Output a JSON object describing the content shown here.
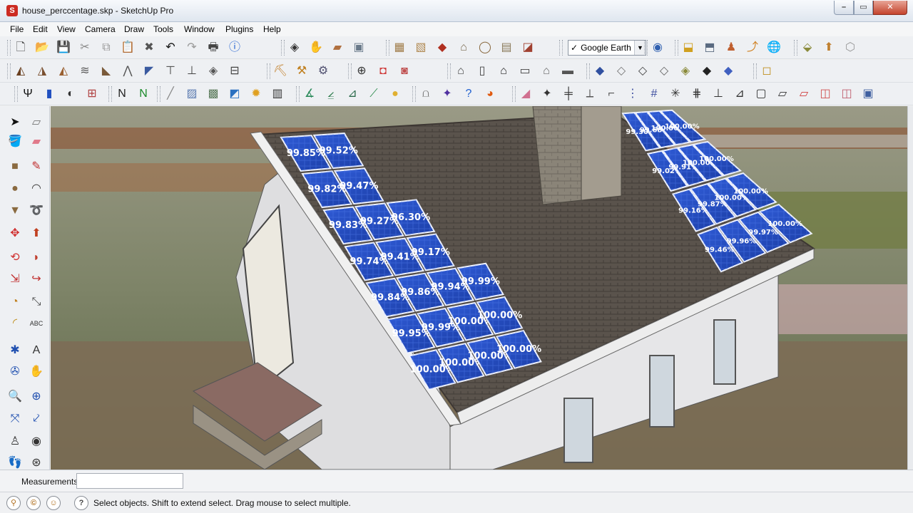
{
  "window": {
    "title": "house_perccentage.skp - SketchUp Pro",
    "icon_glyph": "S",
    "minimize_glyph": "–",
    "maximize_glyph": "▭",
    "close_glyph": "✕"
  },
  "menu": [
    {
      "label": "File",
      "name": "menu-file"
    },
    {
      "label": "Edit",
      "name": "menu-edit"
    },
    {
      "label": "View",
      "name": "menu-view"
    },
    {
      "label": "Camera",
      "name": "menu-camera"
    },
    {
      "label": "Draw",
      "name": "menu-draw"
    },
    {
      "label": "Tools",
      "name": "menu-tools"
    },
    {
      "label": "Window",
      "name": "menu-window"
    },
    {
      "label": "Plugins",
      "name": "menu-plugins"
    },
    {
      "label": "Help",
      "name": "menu-help"
    }
  ],
  "toolbar_rows": [
    {
      "groups": [
        {
          "icons": [
            {
              "name": "new-file-icon",
              "glyph": "🗋",
              "color": "#444444"
            },
            {
              "name": "open-folder-icon",
              "glyph": "📂",
              "color": "#b58a2a"
            },
            {
              "name": "save-icon",
              "glyph": "💾",
              "color": "#2a4f8f"
            },
            {
              "name": "cut-icon",
              "glyph": "✂",
              "color": "#888888"
            },
            {
              "name": "copy-icon",
              "glyph": "⧉",
              "color": "#999999"
            },
            {
              "name": "paste-icon",
              "glyph": "📋",
              "color": "#999999"
            },
            {
              "name": "erase-icon",
              "glyph": "✖",
              "color": "#555555"
            },
            {
              "name": "undo-icon",
              "glyph": "↶",
              "color": "#111111"
            },
            {
              "name": "redo-icon",
              "glyph": "↷",
              "color": "#999999"
            },
            {
              "name": "print-icon",
              "glyph": "🖶",
              "color": "#444444"
            },
            {
              "name": "model-info-icon",
              "glyph": "ⓘ",
              "color": "#1f5fd0"
            }
          ]
        },
        {
          "icons": [
            {
              "name": "make-component-icon",
              "glyph": "◈",
              "color": "#333333"
            },
            {
              "name": "paint-bucket-icon",
              "glyph": "✋",
              "color": "#444444"
            },
            {
              "name": "eraser-tool-icon",
              "glyph": "▰",
              "color": "#b07040"
            },
            {
              "name": "tape-measure-icon",
              "glyph": "▣",
              "color": "#6a7a8a"
            }
          ]
        },
        {
          "icons": [
            {
              "name": "section-plane-icon",
              "glyph": "▦",
              "color": "#a07c48"
            },
            {
              "name": "texture-icon",
              "glyph": "▧",
              "color": "#b08850"
            },
            {
              "name": "push-pull-red-icon",
              "glyph": "◆",
              "color": "#b03020"
            },
            {
              "name": "house-box-icon",
              "glyph": "⌂",
              "color": "#7a6a50"
            },
            {
              "name": "circle-tool-icon",
              "glyph": "◯",
              "color": "#8a6a40"
            },
            {
              "name": "follow-me-icon",
              "glyph": "▤",
              "color": "#8a7a5a"
            },
            {
              "name": "offset-icon",
              "glyph": "◪",
              "color": "#a04030"
            }
          ]
        },
        {
          "icons": [
            {
              "name": "google-earth-get-icon",
              "glyph": "◉",
              "color": "#3060b0"
            }
          ]
        },
        {
          "icons": [
            {
              "name": "get-models-icon",
              "glyph": "⬓",
              "color": "#d0a020"
            },
            {
              "name": "share-model-icon",
              "glyph": "⬒",
              "color": "#5a6a80"
            },
            {
              "name": "person-icon",
              "glyph": "♟",
              "color": "#c06030"
            },
            {
              "name": "axes-icon",
              "glyph": "⤴",
              "color": "#d08020"
            },
            {
              "name": "globe-icon",
              "glyph": "🌐",
              "color": "#2a70c0"
            }
          ]
        },
        {
          "icons": [
            {
              "name": "photo-texture-icon",
              "glyph": "⬙",
              "color": "#8a8a3a"
            },
            {
              "name": "upload-icon",
              "glyph": "⬆",
              "color": "#c08030"
            },
            {
              "name": "cube-outline-icon",
              "glyph": "⬡",
              "color": "#999999"
            }
          ]
        }
      ],
      "google_earth_select": {
        "checkbox": "✓",
        "value": "Google Earth",
        "arrow": "▼"
      }
    },
    {
      "groups": [
        {
          "icons": [
            {
              "name": "roof-tool-1-icon",
              "glyph": "◭",
              "color": "#6a4020"
            },
            {
              "name": "roof-tool-2-icon",
              "glyph": "◮",
              "color": "#7a5030"
            },
            {
              "name": "roof-tool-3-icon",
              "glyph": "◭",
              "color": "#9a6030"
            },
            {
              "name": "stairs-icon",
              "glyph": "≋",
              "color": "#5a5a5a"
            },
            {
              "name": "roof-tool-4-icon",
              "glyph": "◣",
              "color": "#7a5a3a"
            },
            {
              "name": "truss-icon",
              "glyph": "⋀",
              "color": "#555555"
            },
            {
              "name": "roof-tool-5-icon",
              "glyph": "◤",
              "color": "#3a5aa0"
            },
            {
              "name": "column-t-icon",
              "glyph": "⊤",
              "color": "#444444"
            },
            {
              "name": "column-tt-icon",
              "glyph": "⊥",
              "color": "#444444"
            },
            {
              "name": "roof-tool-6-icon",
              "glyph": "◈",
              "color": "#555555"
            },
            {
              "name": "foundation-icon",
              "glyph": "⊟",
              "color": "#444444"
            }
          ]
        },
        {
          "icons": [
            {
              "name": "sandbox-icon",
              "glyph": "⛏",
              "color": "#c07a20"
            },
            {
              "name": "terrain-icon",
              "glyph": "⚒",
              "color": "#c08020"
            },
            {
              "name": "terrain-scale-icon",
              "glyph": "⚙",
              "color": "#505070"
            }
          ]
        },
        {
          "icons": [
            {
              "name": "ruby-console-icon",
              "glyph": "⊕",
              "color": "#333333"
            },
            {
              "name": "cube-red-1-icon",
              "glyph": "◘",
              "color": "#d04040"
            },
            {
              "name": "cube-red-2-icon",
              "glyph": "◙",
              "color": "#c05050"
            }
          ]
        },
        {
          "icons": [
            {
              "name": "view-iso-icon",
              "glyph": "⌂",
              "color": "#444444"
            },
            {
              "name": "view-top-icon",
              "glyph": "▯",
              "color": "#444444"
            },
            {
              "name": "view-front-icon",
              "glyph": "⌂",
              "color": "#222222"
            },
            {
              "name": "view-right-icon",
              "glyph": "▭",
              "color": "#444444"
            },
            {
              "name": "view-back-icon",
              "glyph": "⌂",
              "color": "#666666"
            },
            {
              "name": "view-left-icon",
              "glyph": "▬",
              "color": "#555555"
            }
          ]
        },
        {
          "icons": [
            {
              "name": "xray-style-icon",
              "glyph": "◆",
              "color": "#3050a0"
            },
            {
              "name": "wireframe-style-icon",
              "glyph": "◇",
              "color": "#777777"
            },
            {
              "name": "hidden-line-style-icon",
              "glyph": "◇",
              "color": "#444444"
            },
            {
              "name": "shaded-style-icon",
              "glyph": "◇",
              "color": "#666666"
            },
            {
              "name": "shaded-texture-style-icon",
              "glyph": "◈",
              "color": "#8a8a3a"
            },
            {
              "name": "monochrome-style-icon",
              "glyph": "◆",
              "color": "#222222"
            },
            {
              "name": "back-edges-style-icon",
              "glyph": "◆",
              "color": "#4060c0"
            }
          ]
        },
        {
          "icons": [
            {
              "name": "component-box-icon",
              "glyph": "◻",
              "color": "#c09020"
            }
          ]
        }
      ]
    },
    {
      "groups": [
        {
          "icons": [
            {
              "name": "psi-icon",
              "glyph": "Ψ",
              "color": "#111111"
            },
            {
              "name": "blue-panel-icon",
              "glyph": "▮",
              "color": "#2050c0"
            },
            {
              "name": "moon-icon",
              "glyph": "◐",
              "color": "#333333"
            },
            {
              "name": "render-icon",
              "glyph": "⊞",
              "color": "#b04040"
            }
          ]
        },
        {
          "icons": [
            {
              "name": "n-plugin-icon",
              "glyph": "N",
              "color": "#222222"
            },
            {
              "name": "green-n-plugin-icon",
              "glyph": "N",
              "color": "#1a8a2a"
            }
          ]
        },
        {
          "icons": [
            {
              "name": "ruler-icon",
              "glyph": "╱",
              "color": "#888888"
            },
            {
              "name": "doc-icon",
              "glyph": "▨",
              "color": "#5a7ab0"
            },
            {
              "name": "image-icon",
              "glyph": "▩",
              "color": "#5a7a5a"
            },
            {
              "name": "map-icon",
              "glyph": "◩",
              "color": "#2a70c0"
            },
            {
              "name": "sun-icon",
              "glyph": "✹",
              "color": "#e0a020"
            },
            {
              "name": "chart-icon",
              "glyph": "▥",
              "color": "#333333"
            }
          ]
        },
        {
          "icons": [
            {
              "name": "angle-icon",
              "glyph": "∡",
              "color": "#2a8a5a"
            },
            {
              "name": "protractor-icon",
              "glyph": "⦤",
              "color": "#2a7a4a"
            },
            {
              "name": "utm-icon",
              "glyph": "⊿",
              "color": "#2a6a4a"
            },
            {
              "name": "slope-icon",
              "glyph": "⟋",
              "color": "#2a8a4a"
            },
            {
              "name": "sun-disc-icon",
              "glyph": "●",
              "color": "#e0b030"
            }
          ]
        },
        {
          "icons": [
            {
              "name": "arch-icon",
              "glyph": "⩍",
              "color": "#777777"
            },
            {
              "name": "compass-icon",
              "glyph": "✦",
              "color": "#5030a0"
            },
            {
              "name": "help-icon",
              "glyph": "?",
              "color": "#2060d0"
            },
            {
              "name": "fire-icon",
              "glyph": "◕",
              "color": "#e05a10"
            }
          ]
        },
        {
          "icons": [
            {
              "name": "pink-eraser-icon",
              "glyph": "◢",
              "color": "#d07090"
            },
            {
              "name": "point-icon",
              "glyph": "✦",
              "color": "#333333"
            },
            {
              "name": "grid-icon",
              "glyph": "╪",
              "color": "#333333"
            },
            {
              "name": "dim-icon",
              "glyph": "⟂",
              "color": "#555555"
            },
            {
              "name": "bracket-icon",
              "glyph": "⌐",
              "color": "#555555"
            },
            {
              "name": "dots-grid-icon",
              "glyph": "⋮",
              "color": "#4050a0"
            },
            {
              "name": "hash-grid-icon",
              "glyph": "#",
              "color": "#4050a0"
            },
            {
              "name": "star-axes-icon",
              "glyph": "✳",
              "color": "#333333"
            },
            {
              "name": "lattice-icon",
              "glyph": "⋕",
              "color": "#333333"
            },
            {
              "name": "post-icon",
              "glyph": "⊥",
              "color": "#333333"
            },
            {
              "name": "ramp-icon",
              "glyph": "⊿",
              "color": "#333333"
            },
            {
              "name": "frame-icon",
              "glyph": "▢",
              "color": "#333333"
            },
            {
              "name": "box-3d-icon",
              "glyph": "▱",
              "color": "#333333"
            },
            {
              "name": "slant-box-icon",
              "glyph": "▱",
              "color": "#d04040"
            },
            {
              "name": "pink-box-1-icon",
              "glyph": "◫",
              "color": "#d05050"
            },
            {
              "name": "pink-box-2-icon",
              "glyph": "◫",
              "color": "#c06070"
            },
            {
              "name": "multi-box-icon",
              "glyph": "▣",
              "color": "#4060a0"
            }
          ]
        }
      ]
    }
  ],
  "left_tools": [
    {
      "name": "select-tool-icon",
      "glyph": "➤",
      "color": "#111111"
    },
    {
      "name": "make-component-tool-icon",
      "glyph": "▱",
      "color": "#777777"
    },
    {
      "name": "paint-bucket-tool-icon",
      "glyph": "🪣",
      "color": "#b08020"
    },
    {
      "name": "eraser-icon",
      "glyph": "▰",
      "color": "#e07a8a"
    },
    {
      "name": "rectangle-tool-icon",
      "glyph": "■",
      "color": "#8a6a40"
    },
    {
      "name": "line-tool-icon",
      "glyph": "✎",
      "color": "#c03030"
    },
    {
      "name": "circle-icon",
      "glyph": "●",
      "color": "#8a6a40"
    },
    {
      "name": "arc-tool-icon",
      "glyph": "◠",
      "color": "#444444"
    },
    {
      "name": "polygon-tool-icon",
      "glyph": "▼",
      "color": "#8a6a40"
    },
    {
      "name": "freehand-tool-icon",
      "glyph": "➰",
      "color": "#444444"
    },
    {
      "name": "move-tool-icon",
      "glyph": "✥",
      "color": "#d03030"
    },
    {
      "name": "push-pull-tool-icon",
      "glyph": "⬆",
      "color": "#c04020"
    },
    {
      "name": "rotate-tool-icon",
      "glyph": "⟲",
      "color": "#d03030"
    },
    {
      "name": "follow-me-tool-icon",
      "glyph": "◗",
      "color": "#c04030"
    },
    {
      "name": "scale-tool-icon",
      "glyph": "⇲",
      "color": "#c03030"
    },
    {
      "name": "offset-tool-icon",
      "glyph": "↪",
      "color": "#c03030"
    },
    {
      "name": "tape-measure-tool-icon",
      "glyph": "◔",
      "color": "#c08020"
    },
    {
      "name": "dimension-tool-icon",
      "glyph": "⤡",
      "color": "#444444"
    },
    {
      "name": "protractor-tool-icon",
      "glyph": "◜",
      "color": "#c09020"
    },
    {
      "name": "text-tool-icon",
      "glyph": "ABC",
      "color": "#333333"
    },
    {
      "name": "axes-tool-icon",
      "glyph": "✱",
      "color": "#2050b0"
    },
    {
      "name": "3d-text-tool-icon",
      "glyph": "A",
      "color": "#333333"
    },
    {
      "name": "orbit-tool-icon",
      "glyph": "✇",
      "color": "#2050b0"
    },
    {
      "name": "pan-tool-icon",
      "glyph": "✋",
      "color": "#444444"
    },
    {
      "name": "zoom-tool-icon",
      "glyph": "🔍",
      "color": "#333333"
    },
    {
      "name": "zoom-window-tool-icon",
      "glyph": "⊕",
      "color": "#2050b0"
    },
    {
      "name": "zoom-extents-tool-icon",
      "glyph": "⤧",
      "color": "#2050b0"
    },
    {
      "name": "previous-view-tool-icon",
      "glyph": "⤦",
      "color": "#2050b0"
    },
    {
      "name": "position-camera-tool-icon",
      "glyph": "♙",
      "color": "#333333"
    },
    {
      "name": "look-around-tool-icon",
      "glyph": "◉",
      "color": "#333333"
    },
    {
      "name": "walk-tool-icon",
      "glyph": "👣",
      "color": "#333333"
    },
    {
      "name": "section-plane-tool-icon",
      "glyph": "⊛",
      "color": "#333333"
    }
  ],
  "panels": [
    {
      "label": "99.85%"
    },
    {
      "label": "99.52%"
    },
    {
      "label": "99.82%"
    },
    {
      "label": "99.47%"
    },
    {
      "label": "99.83%"
    },
    {
      "label": "99.27%"
    },
    {
      "label": "96.30%"
    },
    {
      "label": "99.74%"
    },
    {
      "label": "99.41%"
    },
    {
      "label": "99.17%"
    },
    {
      "label": "99.84%"
    },
    {
      "label": "99.86%"
    },
    {
      "label": "99.94%"
    },
    {
      "label": "99.99%"
    },
    {
      "label": "99.95%"
    },
    {
      "label": "99.99%"
    },
    {
      "label": "100.00%"
    },
    {
      "label": "100.00%"
    },
    {
      "label": "100.00%"
    },
    {
      "label": "100.00%"
    },
    {
      "label": "100.00%"
    },
    {
      "label": "100.00%"
    },
    {
      "label": "99.30%"
    },
    {
      "label": "99.02%"
    },
    {
      "label": "99.16%"
    },
    {
      "label": "99.46%"
    },
    {
      "label": "99.68%"
    },
    {
      "label": "99.91%"
    },
    {
      "label": "99.87%"
    },
    {
      "label": "99.96%"
    },
    {
      "label": "100.00%"
    },
    {
      "label": "100.00%"
    },
    {
      "label": "100.00%"
    },
    {
      "label": "99.97%"
    },
    {
      "label": "100.00%"
    },
    {
      "label": "100.00%"
    },
    {
      "label": "100.00%"
    },
    {
      "label": "100.00%"
    }
  ],
  "measurements": {
    "label": "Measurements",
    "value": ""
  },
  "status": {
    "text": "Select objects. Shift to extend select. Drag mouse to select multiple.",
    "geo_glyph": "⚲",
    "credit_glyph": "©",
    "user_glyph": "☺",
    "help_glyph": "?"
  }
}
